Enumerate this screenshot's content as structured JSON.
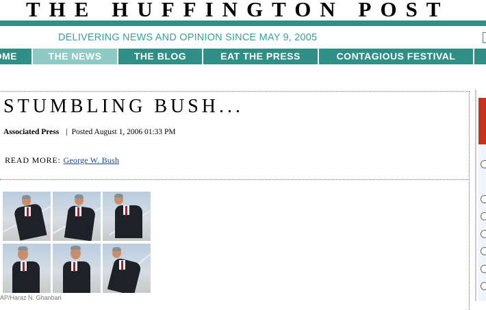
{
  "masthead": {
    "title": "THE HUFFINGTON POST"
  },
  "tagline": "DELIVERING NEWS AND OPINION SINCE MAY 9, 2005",
  "nav": {
    "items": [
      {
        "label": "HOME",
        "active": false
      },
      {
        "label": "THE NEWS",
        "active": true
      },
      {
        "label": "THE BLOG",
        "active": false
      },
      {
        "label": "EAT THE PRESS",
        "active": false
      },
      {
        "label": "CONTAGIOUS FESTIVAL",
        "active": false
      }
    ]
  },
  "article": {
    "title": "STUMBLING BUSH...",
    "source": "Associated Press",
    "separator": "|",
    "posted": "Posted August 1, 2006 01:33 PM",
    "read_more_label": "READ MORE:",
    "read_more_link": "George W. Bush",
    "photo_caption": "AP/Haraz N. Ghanbari"
  },
  "colors": {
    "brand_teal": "#2f8f87",
    "active_tab": "#8fcac4",
    "tagline": "#35a29b",
    "link": "#1a4a8a",
    "sidebar_red": "#c8321b"
  },
  "sidebar": {
    "radio_count": 7
  }
}
